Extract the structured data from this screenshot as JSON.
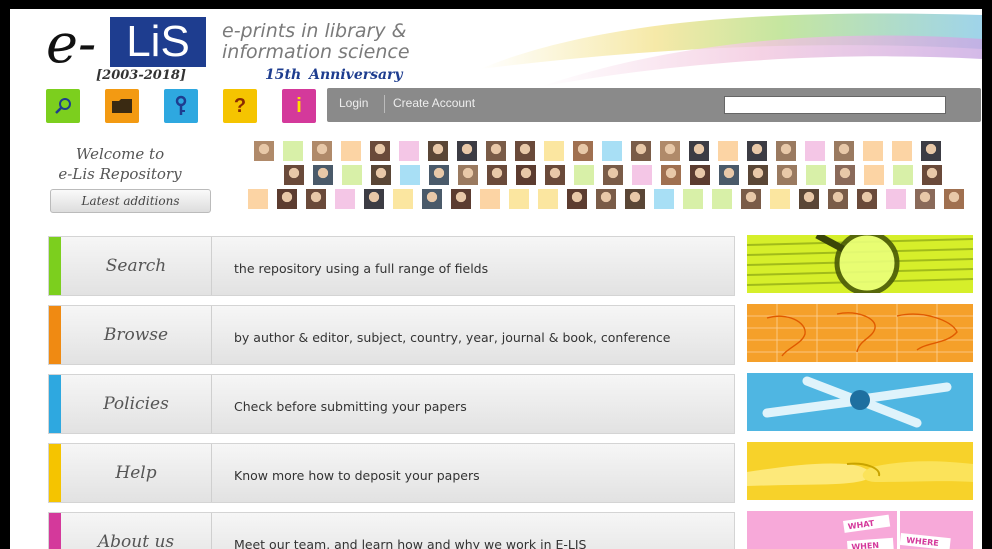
{
  "header": {
    "logo_e": "e-",
    "logo_name": "LiS",
    "logo_years": "[2003-2018]",
    "tagline_line1": "e-prints in library &",
    "tagline_line2": "information science",
    "anniversary_num": "15th",
    "anniversary_word": "Anniversary"
  },
  "toolbar": {
    "icons": [
      {
        "name": "search-icon",
        "color": "#7ccf1e",
        "glyph": "⚲"
      },
      {
        "name": "folder-icon",
        "color": "#f39a12",
        "glyph": ""
      },
      {
        "name": "key-icon",
        "color": "#2ea8e0",
        "glyph": "⚷"
      },
      {
        "name": "help-icon",
        "color": "#f5c400",
        "glyph": "?"
      },
      {
        "name": "info-icon",
        "color": "#d4399b",
        "glyph": "i"
      }
    ],
    "login": "Login",
    "create_account": "Create Account",
    "search_placeholder": ""
  },
  "welcome": {
    "line1": "Welcome to",
    "line2": "e-Lis Repository",
    "latest_button": "Latest additions"
  },
  "sections": [
    {
      "title": "Search",
      "desc": "the repository using a full range of fields",
      "color": "#7ccf1e"
    },
    {
      "title": "Browse",
      "desc": "by author & editor, subject, country, year, journal & book, conference",
      "color": "#f08a12"
    },
    {
      "title": "Policies",
      "desc": "Check before submitting your papers",
      "color": "#2ea8e0"
    },
    {
      "title": "Help",
      "desc": "Know more how to deposit your papers",
      "color": "#f5c400"
    },
    {
      "title": "About us",
      "desc": "Meet our team, and learn how and why we work in E-LIS",
      "color": "#d4399b"
    }
  ],
  "thumb_words": [
    "WHAT",
    "WHERE",
    "WHEN"
  ]
}
